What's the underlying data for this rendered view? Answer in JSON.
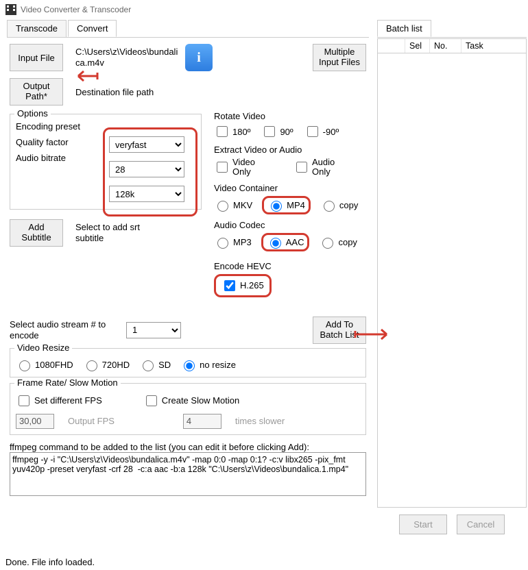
{
  "window": {
    "title": "Video Converter & Transcoder"
  },
  "tabs": {
    "transcode": "Transcode",
    "convert": "Convert",
    "batch": "Batch list"
  },
  "buttons": {
    "input_file": "Input File",
    "output_path": "Output\nPath*",
    "multiple_input": "Multiple\nInput Files",
    "add_subtitle": "Add\nSubtitle",
    "add_to_batch": "Add To\nBatch List",
    "start": "Start",
    "cancel": "Cancel"
  },
  "labels": {
    "input_path": "C:\\Users\\z\\Videos\\bundalica.m4v",
    "dest_path": "Destination file path",
    "options": "Options",
    "encoding_preset": "Encoding preset",
    "quality_factor": "Quality factor",
    "audio_bitrate": "Audio bitrate",
    "subtitle_hint": "Select to add srt subtitle",
    "rotate": "Rotate Video",
    "rot180": "180º",
    "rot90": "90º",
    "rotm90": "-90º",
    "extract": "Extract Video or Audio",
    "video_only": "Video\nOnly",
    "audio_only": "Audio\nOnly",
    "video_container": "Video Container",
    "mkv": "MKV",
    "mp4": "MP4",
    "copy": "copy",
    "audio_codec": "Audio Codec",
    "mp3": "MP3",
    "aac": "AAC",
    "encode_hevc": "Encode HEVC",
    "h265": "H.265",
    "audio_stream": "Select audio stream # to encode",
    "video_resize": "Video Resize",
    "r1080": "1080FHD",
    "r720": "720HD",
    "rsd": "SD",
    "rnone": "no resize",
    "frame_rate": "Frame Rate/ Slow Motion",
    "set_fps": "Set different FPS",
    "output_fps_ph": "Output FPS",
    "create_slow": "Create Slow Motion",
    "times_slower": "times slower",
    "ffmpeg_hint": "ffmpeg command to be added to the list (you can edit it before clicking Add):"
  },
  "values": {
    "preset": "veryfast",
    "quality": "28",
    "abitrate": "128k",
    "audio_stream": "1",
    "fps": "30,00",
    "slow": "4",
    "ffmpeg": "ffmpeg -y -i \"C:\\Users\\z\\Videos\\bundalica.m4v\" -map 0:0 -map 0:1? -c:v libx265 -pix_fmt yuv420p -preset veryfast -crf 28  -c:a aac -b:a 128k \"C:\\Users\\z\\Videos\\bundalica.1.mp4\""
  },
  "batch_cols": {
    "blank": " ",
    "sel": "Sel",
    "no": "No.",
    "task": "Task"
  },
  "status": "Done. File info loaded."
}
